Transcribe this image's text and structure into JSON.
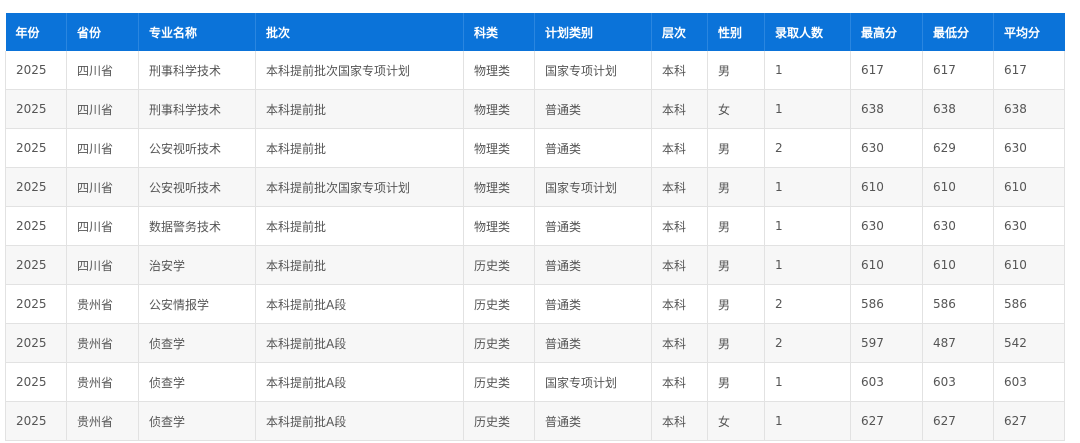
{
  "table": {
    "headers": [
      "年份",
      "省份",
      "专业名称",
      "批次",
      "科类",
      "计划类别",
      "层次",
      "性别",
      "录取人数",
      "最高分",
      "最低分",
      "平均分"
    ],
    "rows": [
      [
        "2025",
        "四川省",
        "刑事科学技术",
        "本科提前批次国家专项计划",
        "物理类",
        "国家专项计划",
        "本科",
        "男",
        "1",
        "617",
        "617",
        "617"
      ],
      [
        "2025",
        "四川省",
        "刑事科学技术",
        "本科提前批",
        "物理类",
        "普通类",
        "本科",
        "女",
        "1",
        "638",
        "638",
        "638"
      ],
      [
        "2025",
        "四川省",
        "公安视听技术",
        "本科提前批",
        "物理类",
        "普通类",
        "本科",
        "男",
        "2",
        "630",
        "629",
        "630"
      ],
      [
        "2025",
        "四川省",
        "公安视听技术",
        "本科提前批次国家专项计划",
        "物理类",
        "国家专项计划",
        "本科",
        "男",
        "1",
        "610",
        "610",
        "610"
      ],
      [
        "2025",
        "四川省",
        "数据警务技术",
        "本科提前批",
        "物理类",
        "普通类",
        "本科",
        "男",
        "1",
        "630",
        "630",
        "630"
      ],
      [
        "2025",
        "四川省",
        "治安学",
        "本科提前批",
        "历史类",
        "普通类",
        "本科",
        "男",
        "1",
        "610",
        "610",
        "610"
      ],
      [
        "2025",
        "贵州省",
        "公安情报学",
        "本科提前批A段",
        "历史类",
        "普通类",
        "本科",
        "男",
        "2",
        "586",
        "586",
        "586"
      ],
      [
        "2025",
        "贵州省",
        "侦查学",
        "本科提前批A段",
        "历史类",
        "普通类",
        "本科",
        "男",
        "2",
        "597",
        "487",
        "542"
      ],
      [
        "2025",
        "贵州省",
        "侦查学",
        "本科提前批A段",
        "历史类",
        "国家专项计划",
        "本科",
        "男",
        "1",
        "603",
        "603",
        "603"
      ],
      [
        "2025",
        "贵州省",
        "侦查学",
        "本科提前批A段",
        "历史类",
        "普通类",
        "本科",
        "女",
        "1",
        "627",
        "627",
        "627"
      ]
    ]
  },
  "colors": {
    "header_bg": "#0b73d9",
    "header_text": "#ffffff",
    "cell_text": "#555555",
    "border": "#e2e2e2",
    "stripe": "#f7f7f7"
  }
}
